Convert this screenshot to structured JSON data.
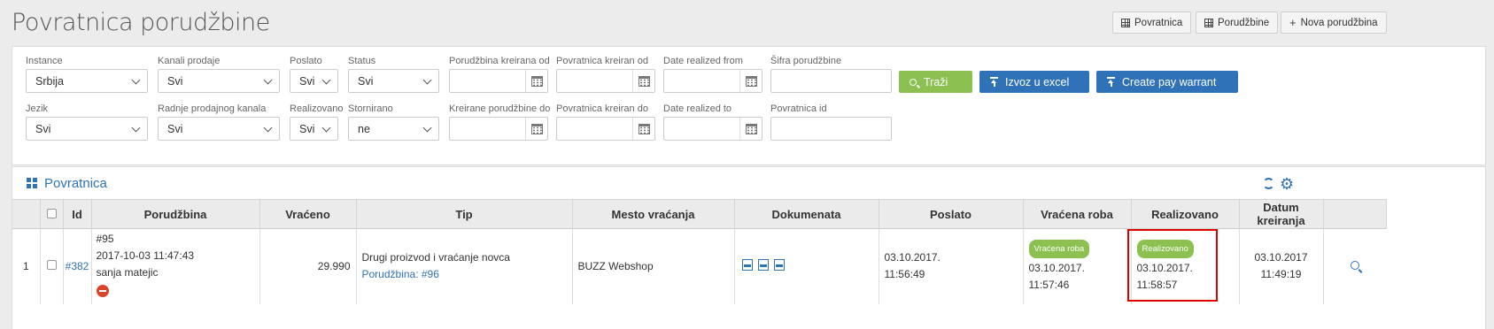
{
  "page": {
    "title": "Povratnica porudžbine"
  },
  "top_buttons": {
    "povratnica": "Povratnica",
    "porudzbine": "Porudžbine",
    "nova": "Nova porudžbina"
  },
  "filters": {
    "instance": {
      "label": "Instance",
      "value": "Srbija"
    },
    "kanali": {
      "label": "Kanali prodaje",
      "value": "Svi"
    },
    "poslato": {
      "label": "Poslato",
      "value": "Svi"
    },
    "status": {
      "label": "Status",
      "value": "Svi"
    },
    "porudzbina_od": {
      "label": "Porudžbina kreirana od",
      "value": ""
    },
    "povratnica_od": {
      "label": "Povratnica kreiran od",
      "value": ""
    },
    "realized_from": {
      "label": "Date realized from",
      "value": ""
    },
    "sifra": {
      "label": "Šifra porudžbine",
      "value": ""
    },
    "jezik": {
      "label": "Jezik",
      "value": "Svi"
    },
    "radnje": {
      "label": "Radnje prodajnog kanala",
      "value": "Svi"
    },
    "realizovano": {
      "label": "Realizovano",
      "value": "Svi"
    },
    "stornirano": {
      "label": "Stornirano",
      "value": "ne"
    },
    "porudzbine_do": {
      "label": "Kreirane porudžbine do",
      "value": ""
    },
    "povratnica_do": {
      "label": "Povratnica kreiran do",
      "value": ""
    },
    "realized_to": {
      "label": "Date realized to",
      "value": ""
    },
    "povratnica_id": {
      "label": "Povratnica id",
      "value": ""
    }
  },
  "actions": {
    "trazi": "Traži",
    "excel": "Izvoz u excel",
    "warrant": "Create pay warrant"
  },
  "table_panel": {
    "title": "Povratnica",
    "headers": {
      "id": "Id",
      "porudzbina": "Porudžbina",
      "vraceno": "Vraćeno",
      "tip": "Tip",
      "mesto": "Mesto vraćanja",
      "dokumenata": "Dokumenata",
      "poslato": "Poslato",
      "vracena_roba": "Vraćena roba",
      "realizovano": "Realizovano",
      "datum": "Datum kreiranja"
    },
    "rows": [
      {
        "num": "1",
        "id": "#382",
        "order_no": "#95",
        "order_date": "2017-10-03 11:47:43",
        "customer": "sanja matejic",
        "vraceno": "29.990",
        "tip": "Drugi proizvod i vraćanje novca",
        "tip_link": "Porudžbina: #96",
        "mesto": "BUZZ Webshop",
        "poslato_date": "03.10.2017.",
        "poslato_time": "11:56:49",
        "vracena_badge": "Vraćena roba",
        "vracena_date": "03.10.2017.",
        "vracena_time": "11:57:46",
        "real_badge": "Realizovano",
        "real_date": "03.10.2017.",
        "real_time": "11:58:57",
        "datum_date": "03.10.2017",
        "datum_time": "11:49:19"
      }
    ]
  },
  "colors": {
    "accent_blue": "#2f72b8",
    "green": "#8cc152",
    "highlight_red": "#e00000"
  }
}
